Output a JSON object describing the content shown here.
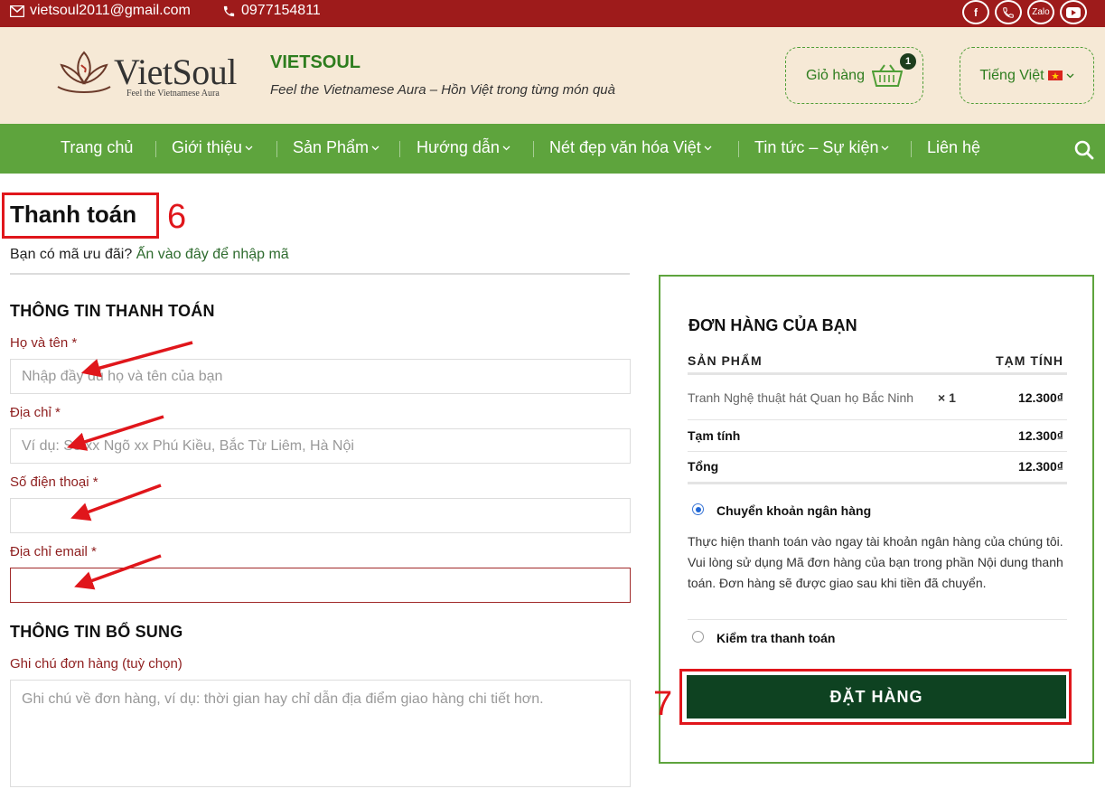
{
  "topbar": {
    "email": "vietsoul2011@gmail.com",
    "phone": "0977154811",
    "social": {
      "facebook": "f",
      "zalo": "Zalo"
    }
  },
  "header": {
    "logo_text": "VietSoul",
    "logo_tagline": "Feel the Vietnamese Aura",
    "brand_name": "VIETSOUL",
    "brand_tagline": "Feel the Vietnamese Aura – Hồn Việt trong từng món quà",
    "cart_label": "Giỏ hàng",
    "cart_count": "1",
    "language_label": "Tiếng Việt"
  },
  "nav": {
    "items": [
      {
        "label": "Trang chủ"
      },
      {
        "label": "Giới thiệu"
      },
      {
        "label": "Sản Phẩm"
      },
      {
        "label": "Hướng dẫn"
      },
      {
        "label": "Nét đẹp văn hóa Việt"
      },
      {
        "label": "Tin tức – Sự kiện"
      },
      {
        "label": "Liên hệ"
      }
    ]
  },
  "checkout": {
    "title": "Thanh toán",
    "coupon_text": "Bạn có mã ưu đãi?",
    "coupon_link": "Ấn vào đây để nhập mã",
    "billing_heading": "THÔNG TIN THANH TOÁN",
    "fields": {
      "name_label": "Họ và tên *",
      "name_placeholder": "Nhập đầy đủ họ và tên của bạn",
      "address_label": "Địa chỉ *",
      "address_placeholder": "Ví dụ: Số xx Ngõ xx Phú Kiều, Bắc Từ Liêm, Hà Nội",
      "phone_label": "Số điện thoại *",
      "email_label": "Địa chỉ email *"
    },
    "additional_heading": "THÔNG TIN BỔ SUNG",
    "notes_label": "Ghi chú đơn hàng (tuỳ chọn)",
    "notes_placeholder": "Ghi chú về đơn hàng, ví dụ: thời gian hay chỉ dẫn địa điểm giao hàng chi tiết hơn."
  },
  "order": {
    "heading": "ĐƠN HÀNG CỦA BẠN",
    "col_product": "SẢN PHẨM",
    "col_subtotal": "TẠM TÍNH",
    "product_name": "Tranh Nghệ thuật hát Quan họ Bắc Ninh",
    "product_qty": "× 1",
    "product_amount": "12.300₫",
    "subtotal_label": "Tạm tính",
    "subtotal_amount": "12.300₫",
    "total_label": "Tổng",
    "total_amount": "12.300₫",
    "payment_bank": "Chuyển khoản ngân hàng",
    "payment_bank_desc": "Thực hiện thanh toán vào ngay tài khoản ngân hàng của chúng tôi. Vui lòng sử dụng Mã đơn hàng của bạn trong phần Nội dung thanh toán. Đơn hàng sẽ được giao sau khi tiền đã chuyển.",
    "payment_check": "Kiểm tra thanh toán",
    "place_order": "ĐẶT HÀNG"
  },
  "annotations": {
    "step_title": "6",
    "step_button": "7"
  },
  "colors": {
    "topbar": "#9e1b1b",
    "header_bg": "#f6e9d6",
    "nav_bg": "#5ea43d",
    "brand_green": "#2e7d1e",
    "button_dark_green": "#0e4221",
    "annotation_red": "#e0161b",
    "label_red": "#8f2020"
  }
}
